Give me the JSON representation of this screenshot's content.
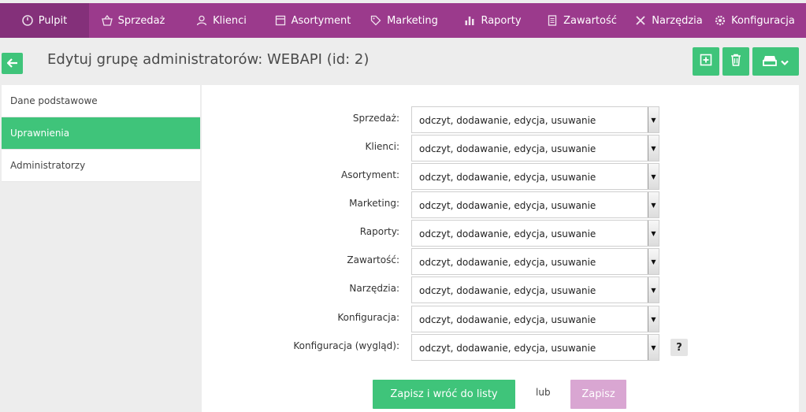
{
  "nav": {
    "items": [
      {
        "label": "Pulpit",
        "icon": "dashboard-icon",
        "active": true
      },
      {
        "label": "Sprzedaż",
        "icon": "basket-icon"
      },
      {
        "label": "Klienci",
        "icon": "users-icon"
      },
      {
        "label": "Asortyment",
        "icon": "box-icon"
      },
      {
        "label": "Marketing",
        "icon": "tag-icon"
      },
      {
        "label": "Raporty",
        "icon": "bar-chart-icon"
      },
      {
        "label": "Zawartość",
        "icon": "document-icon"
      },
      {
        "label": "Narzędzia",
        "icon": "tools-icon"
      },
      {
        "label": "Konfiguracja",
        "icon": "gear-icon"
      }
    ]
  },
  "header": {
    "title": "Edytuj grupę administratorów: WEBAPI (id: 2)"
  },
  "sidebar": {
    "items": [
      {
        "label": "Dane podstawowe"
      },
      {
        "label": "Uprawnienia",
        "active": true
      },
      {
        "label": "Administratorzy"
      }
    ]
  },
  "permissions": [
    {
      "label": "Sprzedaż:",
      "value": "odczyt, dodawanie, edycja, usuwanie"
    },
    {
      "label": "Klienci:",
      "value": "odczyt, dodawanie, edycja, usuwanie"
    },
    {
      "label": "Asortyment:",
      "value": "odczyt, dodawanie, edycja, usuwanie"
    },
    {
      "label": "Marketing:",
      "value": "odczyt, dodawanie, edycja, usuwanie"
    },
    {
      "label": "Raporty:",
      "value": "odczyt, dodawanie, edycja, usuwanie"
    },
    {
      "label": "Zawartość:",
      "value": "odczyt, dodawanie, edycja, usuwanie"
    },
    {
      "label": "Narzędzia:",
      "value": "odczyt, dodawanie, edycja, usuwanie"
    },
    {
      "label": "Konfiguracja:",
      "value": "odczyt, dodawanie, edycja, usuwanie"
    },
    {
      "label": "Konfiguracja (wygląd):",
      "value": "odczyt, dodawanie, edycja, usuwanie"
    }
  ],
  "help": {
    "label": "?"
  },
  "actions": {
    "save_back": "Zapisz i wróć do listy",
    "or": "lub",
    "save": "Zapisz"
  },
  "colors": {
    "nav_bg": "#9b3a8c",
    "accent_green": "#3fc47a",
    "save_disabled": "#d9a6d2"
  }
}
